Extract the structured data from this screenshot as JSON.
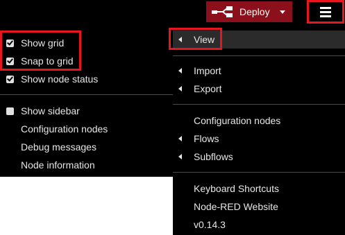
{
  "header": {
    "deploy_label": "Deploy",
    "deploy_icon": "flow-deploy-icon",
    "deploy_color": "#8c101c",
    "menu_icon": "hamburger-icon"
  },
  "left_menu": {
    "items": [
      {
        "label": "Show grid",
        "checked": true
      },
      {
        "label": "Snap to grid",
        "checked": true
      },
      {
        "label": "Show node status",
        "checked": true
      },
      {
        "label": "Show sidebar",
        "checked": false
      },
      {
        "label": "Configuration nodes"
      },
      {
        "label": "Debug messages"
      },
      {
        "label": "Node information"
      }
    ]
  },
  "right_menu": {
    "items": [
      {
        "label": "View",
        "submenu": true
      },
      {
        "label": "Import",
        "submenu": true
      },
      {
        "label": "Export",
        "submenu": true
      },
      {
        "label": "Configuration nodes",
        "submenu": false
      },
      {
        "label": "Flows",
        "submenu": true
      },
      {
        "label": "Subflows",
        "submenu": true
      },
      {
        "label": "Keyboard Shortcuts",
        "submenu": false
      },
      {
        "label": "Node-RED Website",
        "submenu": false
      },
      {
        "label": "v0.14.3",
        "submenu": false
      }
    ]
  },
  "colors": {
    "highlight": "#e8151f",
    "menu_background": "#000000",
    "menu_text": "#e6e6e6",
    "divider": "#4a4a4a"
  }
}
